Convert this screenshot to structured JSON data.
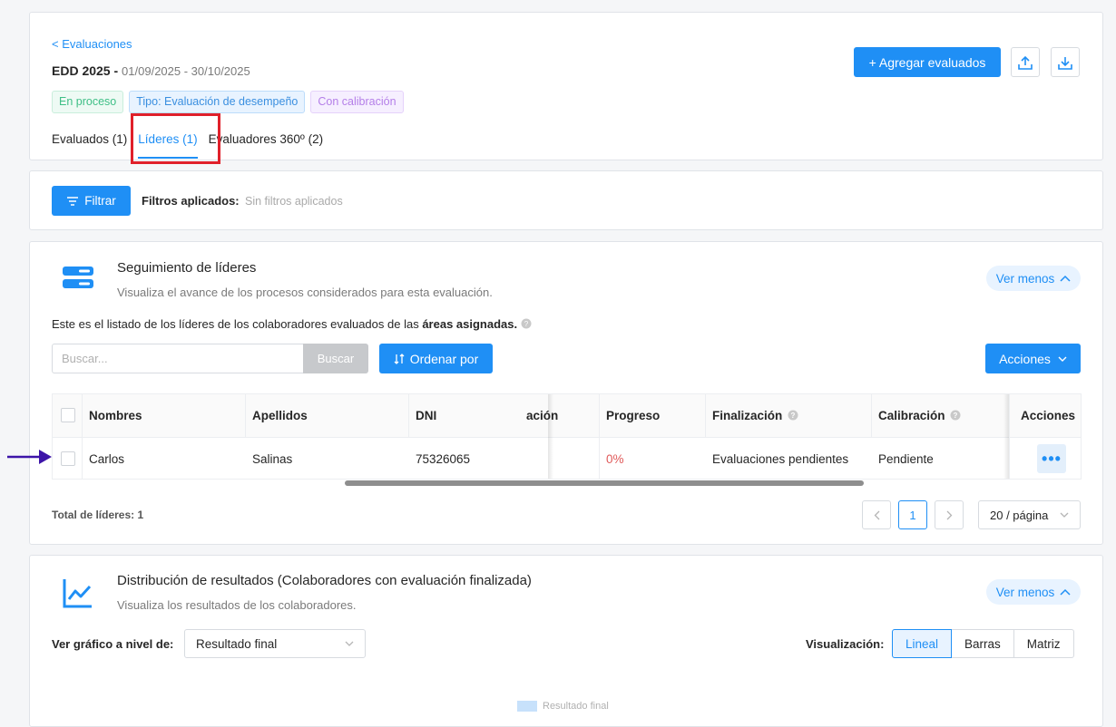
{
  "header": {
    "back_link": "< Evaluaciones",
    "title": "EDD 2025 -",
    "dates": "01/09/2025 - 30/10/2025",
    "tags": [
      "En proceso",
      "Tipo: Evaluación de desempeño",
      "Con calibración"
    ],
    "tabs": [
      "Evaluados (1)",
      "Líderes (1)",
      "Evaluadores 360º (2)"
    ],
    "add_button": "+ Agregar evaluados"
  },
  "filters": {
    "button": "Filtrar",
    "label": "Filtros aplicados:",
    "value": "Sin filtros aplicados"
  },
  "leaders": {
    "title": "Seguimiento de líderes",
    "subtitle": "Visualiza el avance de los procesos considerados para esta evaluación.",
    "toggle": "Ver menos",
    "description_pre": "Este es el listado de los líderes de los colaboradores evaluados de las",
    "description_bold": "áreas asignadas.",
    "search_placeholder": "Buscar...",
    "search_button": "Buscar",
    "order_button": "Ordenar por",
    "actions_button": "Acciones",
    "columns": [
      "Nombres",
      "Apellidos",
      "DNI",
      "ación",
      "Progreso",
      "Finalización",
      "Calibración",
      "Acciones"
    ],
    "row": {
      "nombres": "Carlos",
      "apellidos": "Salinas",
      "dni": "75326065",
      "progreso": "0%",
      "finalizacion": "Evaluaciones pendientes",
      "calibracion": "Pendiente",
      "acciones": "•••"
    },
    "total": "Total de líderes: 1",
    "current_page": "1",
    "page_size": "20 / página"
  },
  "distribution": {
    "title": "Distribución de resultados",
    "title_paren": "(Colaboradores con evaluación finalizada)",
    "subtitle": "Visualiza los resultados de los colaboradores.",
    "toggle": "Ver menos",
    "level_label": "Ver gráfico a nivel de:",
    "level_value": "Resultado final",
    "vis_label": "Visualización:",
    "vis_options": [
      "Lineal",
      "Barras",
      "Matriz"
    ],
    "vis_selected": "Lineal",
    "legend": "Resultado final"
  },
  "colors": {
    "primary": "#1f8ff5",
    "highlight_box": "#e0202a",
    "annotation_arrow": "#3d14a8",
    "progress_zero": "#e05a5a"
  }
}
